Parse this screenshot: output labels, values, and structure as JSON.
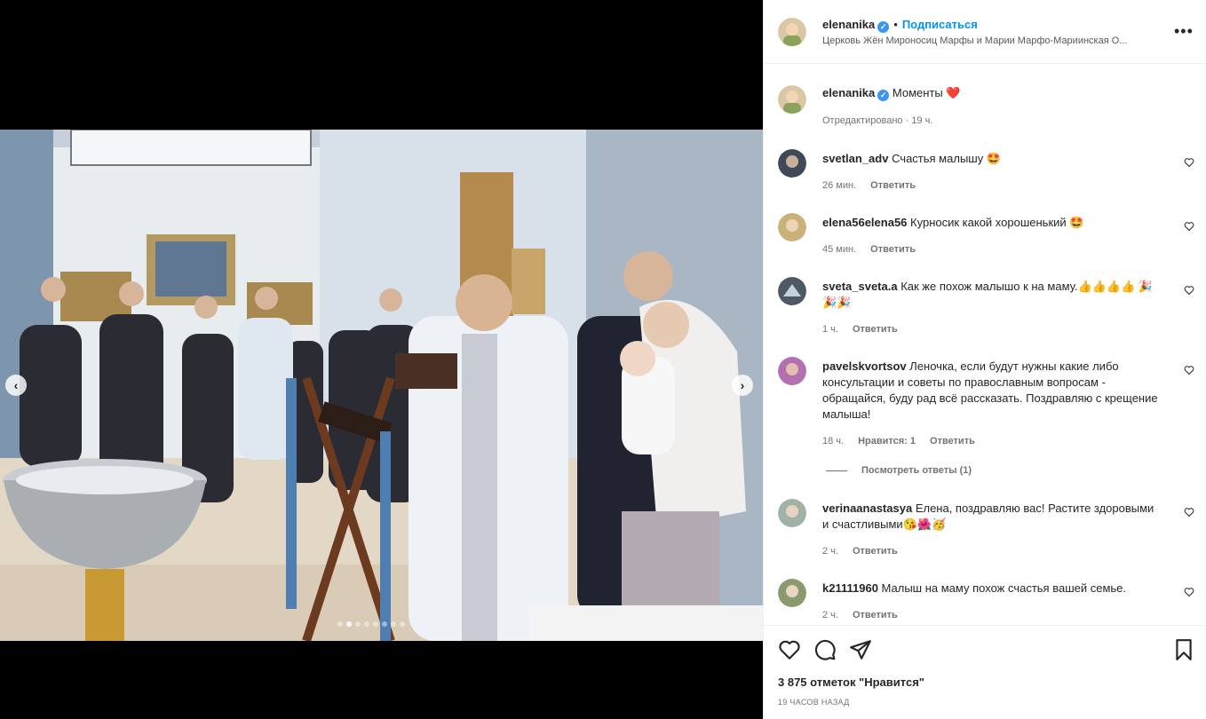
{
  "post": {
    "username": "elenanika",
    "follow_label": "Подписаться",
    "location": "Церковь Жён Мироносиц Марфы и Марии Марфо-Мариинская О...",
    "caption": "Моменты",
    "caption_emoji": "❤️",
    "caption_meta": "Отредактировано · 19 ч.",
    "likes": "3 875 отметок \"Нравится\"",
    "time_ago": "19 ЧАСОВ НАЗАД",
    "carousel": {
      "total_slides": 8,
      "active_slide": 2
    }
  },
  "comments": [
    {
      "user": "svetlan_adv",
      "text": "Счастья малышу 🤩",
      "time": "26 мин.",
      "likes": "",
      "reply": "Ответить"
    },
    {
      "user": "elena56elena56",
      "text": "Курносик какой хорошенький 🤩",
      "time": "45 мин.",
      "likes": "",
      "reply": "Ответить"
    },
    {
      "user": "sveta_sveta.a",
      "text": "Как же похож малышо к на маму.👍👍👍👍 🎉🎉🎉",
      "time": "1 ч.",
      "likes": "",
      "reply": "Ответить"
    },
    {
      "user": "pavelskvortsov",
      "text": "Леночка, если будут нужны какие либо консультации и советы по православным вопросам - обращайся, буду рад всё рассказать. Поздравляю с крещение малыша!",
      "time": "18 ч.",
      "likes": "Нравится: 1",
      "reply": "Ответить"
    },
    {
      "user": "verinaanastasya",
      "text": "Елена, поздравляю вас! Растите здоровыми и счастливыми😘🌺🥳",
      "time": "2 ч.",
      "likes": "",
      "reply": "Ответить"
    },
    {
      "user": "k21111960",
      "text": "Малыш на маму похож счастья вашей семье.",
      "time": "2 ч.",
      "likes": "",
      "reply": "Ответить"
    }
  ],
  "view_replies": "Посмотреть ответы (1)",
  "icons": {
    "verified": "verified-badge-icon",
    "more": "more-options-icon",
    "like": "heart-icon",
    "comment": "comment-icon",
    "share": "share-icon",
    "save": "bookmark-icon"
  },
  "colors": {
    "accent": "#0095f6",
    "verified": "#3897f0",
    "heart": "#ed4956"
  }
}
